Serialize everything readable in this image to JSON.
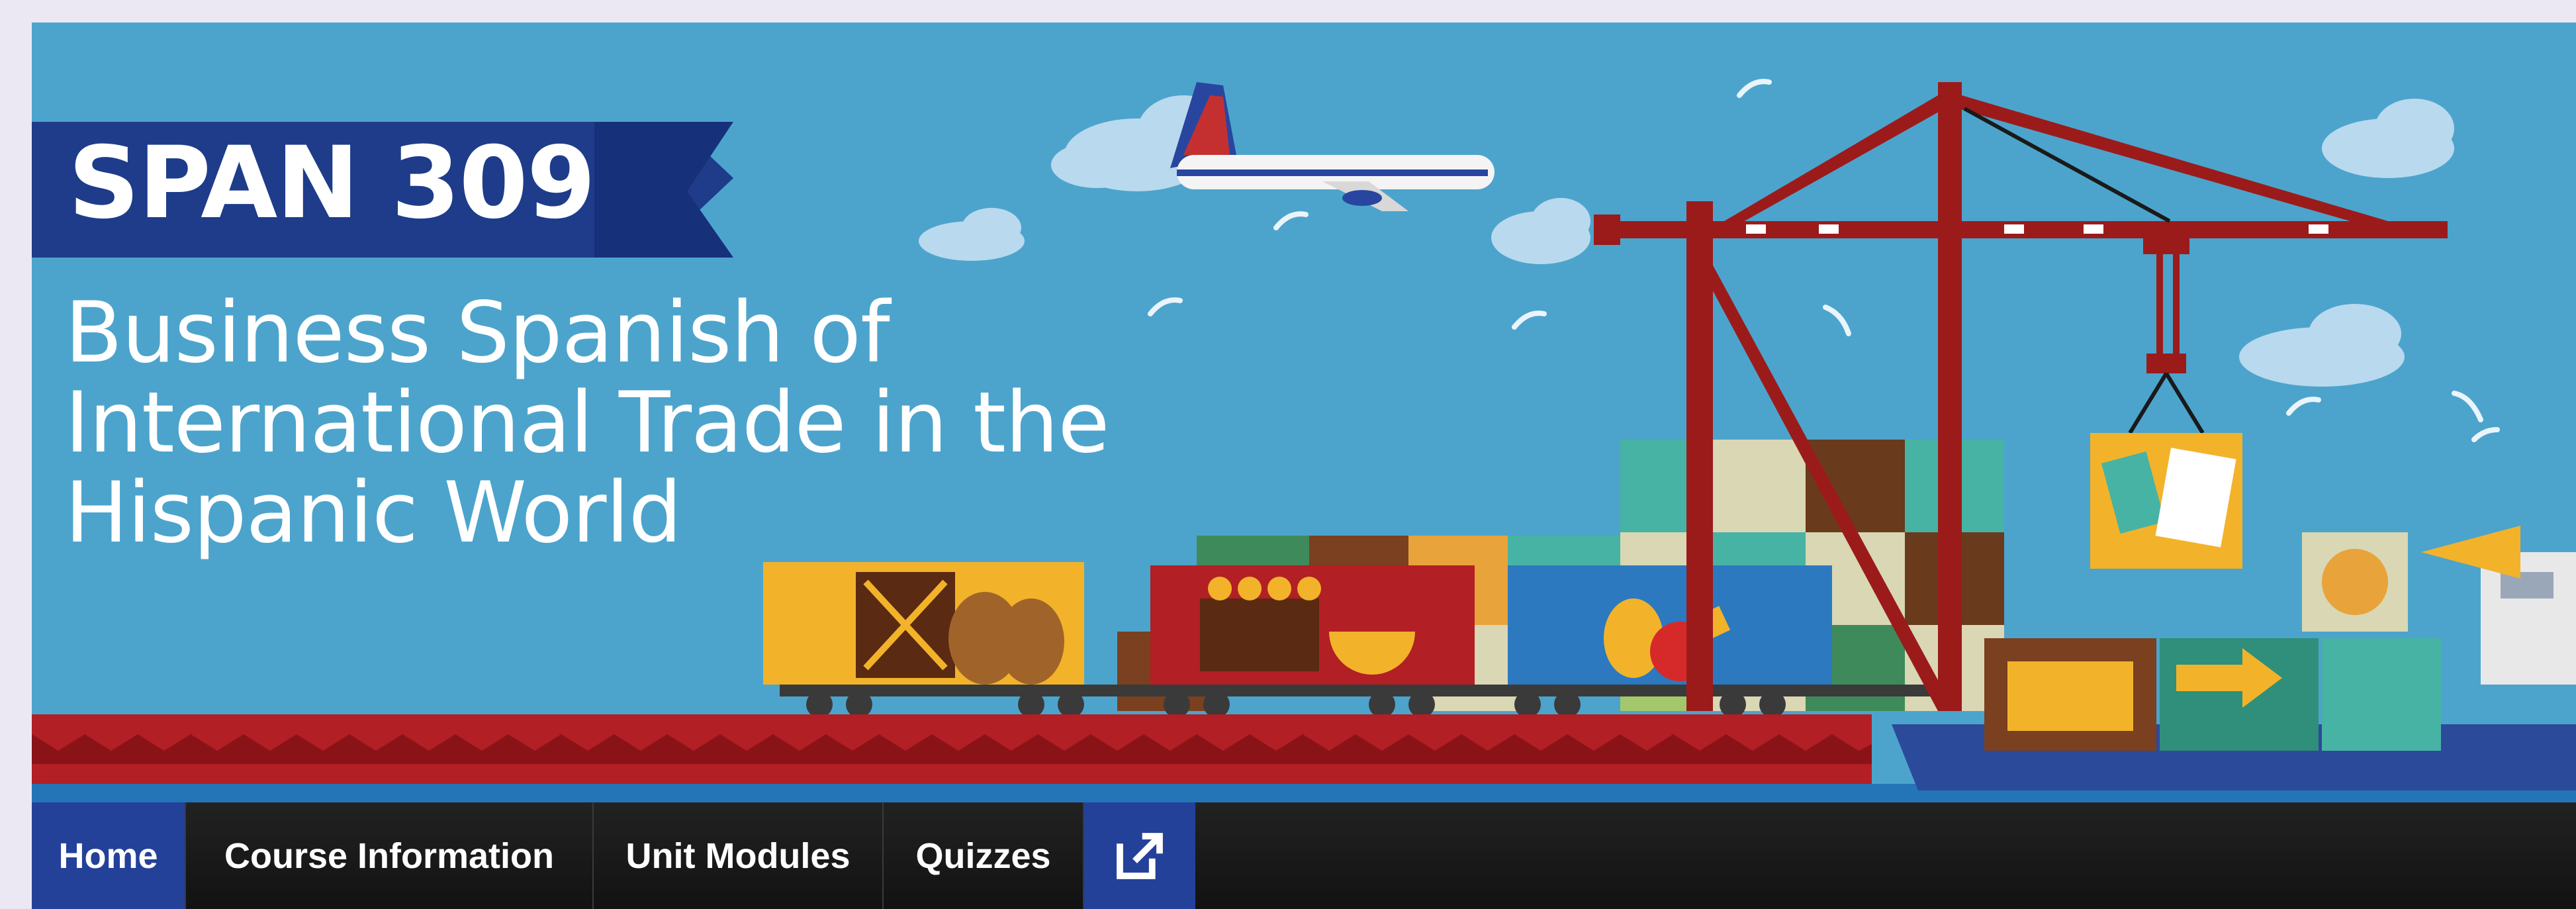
{
  "banner": {
    "course_code": "SPAN 309",
    "course_title": "Business Spanish of\nInternational Trade in the\nHispanic World"
  },
  "nav": {
    "items": [
      {
        "label": "Home",
        "active": true
      },
      {
        "label": "Course Information"
      },
      {
        "label": "Unit Modules"
      },
      {
        "label": "Quizzes"
      }
    ],
    "external_icon": "external-link-icon"
  },
  "colors": {
    "sky": "#4ca4cc",
    "ribbon": "#1e3c8a",
    "crane": "#9b1b1b",
    "nav_bg": "#1a1a1a",
    "nav_active": "#24419a"
  }
}
